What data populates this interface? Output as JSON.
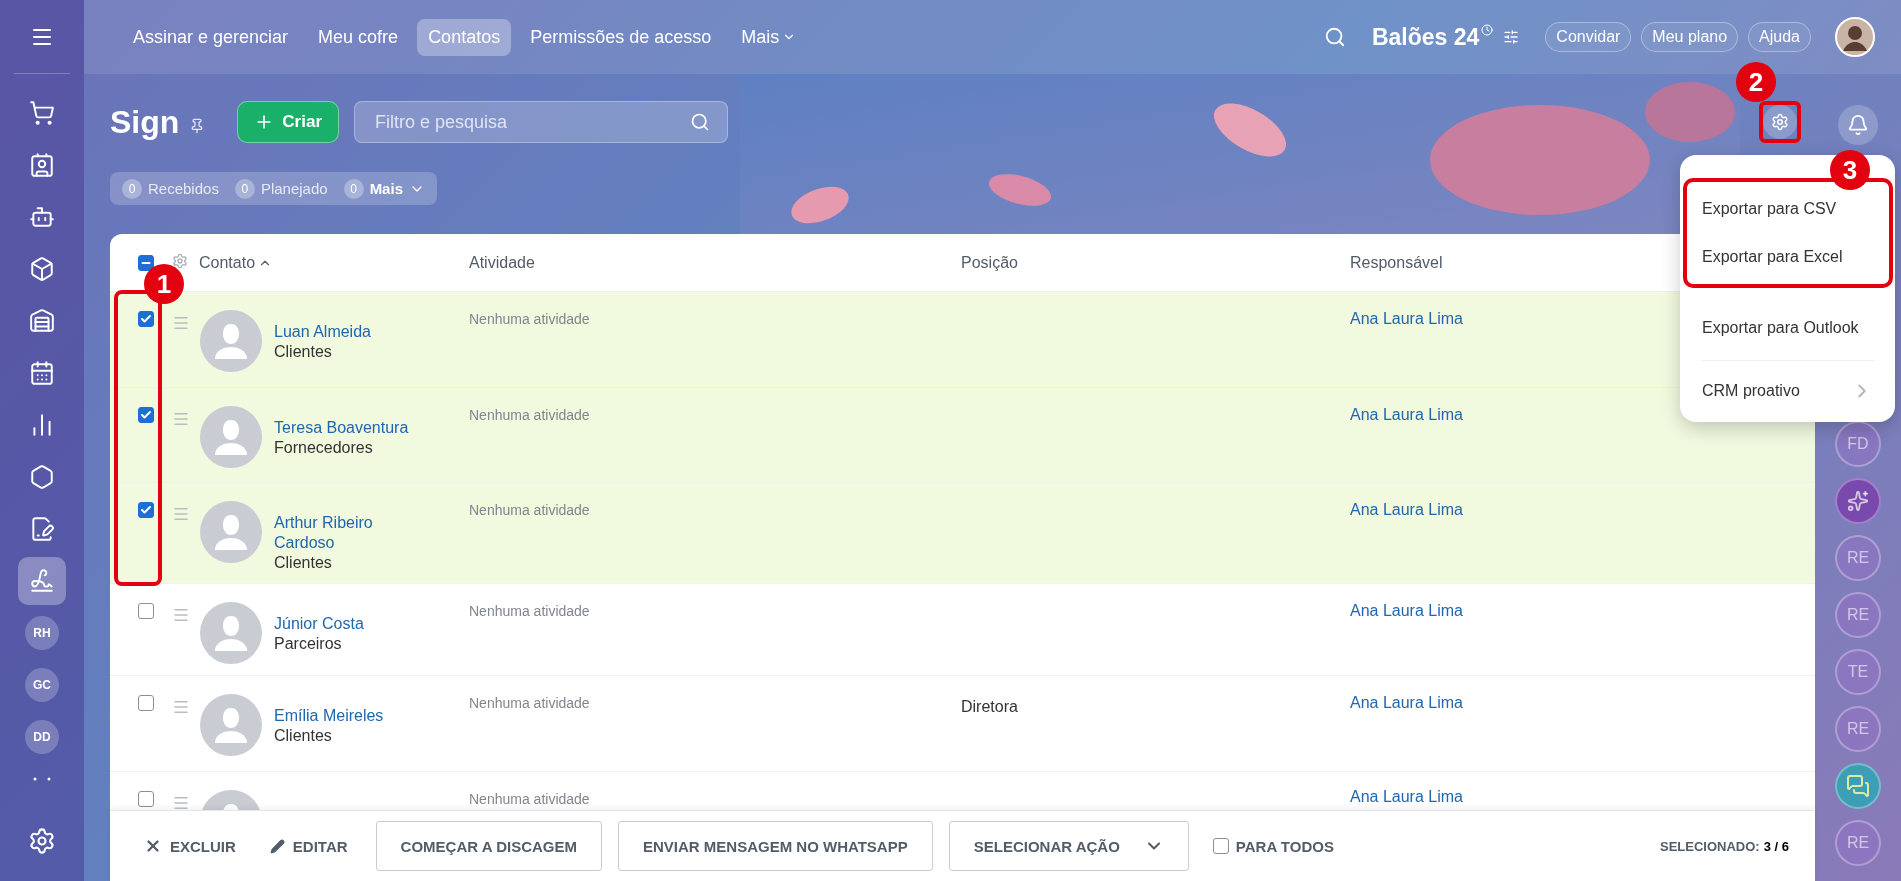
{
  "nav": {
    "items": [
      {
        "label": "Assinar e gerenciar",
        "selected": false
      },
      {
        "label": "Meu cofre",
        "selected": false
      },
      {
        "label": "Contatos",
        "selected": true
      },
      {
        "label": "Permissões de acesso",
        "selected": false
      }
    ],
    "more": "Mais"
  },
  "account": {
    "company": "Balões 24",
    "buttons": [
      "Convidar",
      "Meu plano",
      "Ajuda"
    ]
  },
  "sidebar": {
    "items": [
      {
        "kind": "icon",
        "selected": false
      },
      {
        "kind": "icon",
        "selected": false
      },
      {
        "kind": "icon",
        "selected": false
      },
      {
        "kind": "icon",
        "selected": false
      },
      {
        "kind": "icon",
        "selected": false
      },
      {
        "kind": "icon",
        "selected": false
      },
      {
        "kind": "icon",
        "selected": false
      },
      {
        "kind": "icon",
        "selected": false
      },
      {
        "kind": "icon",
        "selected": false
      },
      {
        "kind": "icon",
        "selected": true
      },
      {
        "kind": "initials",
        "label": "RH",
        "selected": false
      },
      {
        "kind": "initials",
        "label": "GC",
        "selected": false
      },
      {
        "kind": "initials",
        "label": "DD",
        "selected": false
      }
    ]
  },
  "page": {
    "title": "Sign",
    "create_button": "Criar",
    "search": {
      "placeholder": "Filtro e pesquisa"
    }
  },
  "counters": [
    {
      "count": "0",
      "label": "Recebidos",
      "kind": "counter"
    },
    {
      "count": "0",
      "label": "Planejado",
      "kind": "counter"
    },
    {
      "count": "0",
      "label": "Mais",
      "kind": "dropdown"
    }
  ],
  "table": {
    "select_all_partial": true,
    "columns": [
      {
        "label": "Contato",
        "sorted": true
      },
      {
        "label": "Atividade",
        "sorted": false
      },
      {
        "label": "Posição",
        "sorted": false
      },
      {
        "label": "Responsável",
        "sorted": false
      }
    ],
    "rows": [
      {
        "selected": true,
        "name": "Luan Almeida",
        "group": "Clientes",
        "activity": "Nenhuma atividade",
        "owner": "Ana Laura Lima"
      },
      {
        "selected": true,
        "name": "Teresa Boaventura",
        "group": "Fornecedores",
        "activity": "Nenhuma atividade",
        "owner": "Ana Laura Lima"
      },
      {
        "selected": true,
        "name": "Arthur Ribeiro Cardoso",
        "group": "Clientes",
        "activity": "Nenhuma atividade",
        "owner": "Ana Laura Lima"
      },
      {
        "selected": false,
        "name": "Júnior Costa",
        "group": "Parceiros",
        "activity": "Nenhuma atividade",
        "owner": "Ana Laura Lima"
      },
      {
        "selected": false,
        "name": "Emília Meireles",
        "group": "Clientes",
        "activity": "Nenhuma atividade",
        "position": "Diretora",
        "owner": "Ana Laura Lima"
      },
      {
        "selected": false,
        "activity": "Nenhuma atividade",
        "owner": "Ana Laura Lima"
      }
    ]
  },
  "menu": {
    "items": [
      {
        "label": "Exportar para CSV",
        "kind": "item"
      },
      {
        "label": "Exportar para Excel",
        "kind": "item"
      },
      {
        "label": "Exportar para Outlook",
        "kind": "item"
      },
      {
        "label": "CRM proativo",
        "kind": "submenu"
      }
    ]
  },
  "annotations": [
    {
      "label": "1"
    },
    {
      "label": "2"
    },
    {
      "label": "3"
    }
  ],
  "bottom_bar": {
    "actions": [
      {
        "kind": "delete",
        "label": "EXCLUIR"
      },
      {
        "kind": "edit",
        "label": "EDITAR"
      },
      {
        "kind": "button",
        "label": "COMEÇAR A DISCAGEM"
      },
      {
        "kind": "button",
        "label": "ENVIAR MENSAGEM NO WHATSAPP"
      },
      {
        "kind": "select",
        "label": "SELECIONAR AÇÃO"
      }
    ],
    "for_all": {
      "label": "PARA TODOS",
      "checked": false
    },
    "selected": {
      "label": "SELECIONADO:",
      "value": "3 / 6"
    }
  },
  "right_bar": {
    "items": [
      {
        "kind": "initials",
        "label": "FD"
      },
      {
        "kind": "icon"
      },
      {
        "kind": "initials",
        "label": "RE"
      },
      {
        "kind": "initials",
        "label": "RE"
      },
      {
        "kind": "initials",
        "label": "TE"
      },
      {
        "kind": "initials",
        "label": "RE"
      },
      {
        "kind": "chat"
      },
      {
        "kind": "initials",
        "label": "RE"
      }
    ]
  }
}
